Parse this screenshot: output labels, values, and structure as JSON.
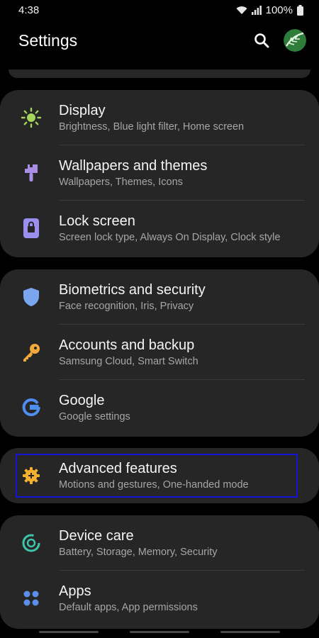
{
  "status": {
    "time": "4:38",
    "battery": "100%"
  },
  "header": {
    "title": "Settings"
  },
  "groups": [
    {
      "items": [
        {
          "title": "Display",
          "subtitle": "Brightness, Blue light filter, Home screen",
          "icon": "sun-icon",
          "color": "#a4d65e"
        },
        {
          "title": "Wallpapers and themes",
          "subtitle": "Wallpapers, Themes, Icons",
          "icon": "paintbrush-icon",
          "color": "#a98ee6"
        },
        {
          "title": "Lock screen",
          "subtitle": "Screen lock type, Always On Display, Clock style",
          "icon": "lock-icon",
          "color": "#9a8ef0"
        }
      ]
    },
    {
      "items": [
        {
          "title": "Biometrics and security",
          "subtitle": "Face recognition, Iris, Privacy",
          "icon": "shield-icon",
          "color": "#7aa6f0"
        },
        {
          "title": "Accounts and backup",
          "subtitle": "Samsung Cloud, Smart Switch",
          "icon": "key-icon",
          "color": "#f3a93a"
        },
        {
          "title": "Google",
          "subtitle": "Google settings",
          "icon": "google-icon",
          "color": "#4e8ef0"
        }
      ]
    },
    {
      "items": [
        {
          "title": "Advanced features",
          "subtitle": "Motions and gestures, One-handed mode",
          "icon": "gear-plus-icon",
          "color": "#f2b02e"
        }
      ]
    },
    {
      "items": [
        {
          "title": "Device care",
          "subtitle": "Battery, Storage, Memory, Security",
          "icon": "device-care-icon",
          "color": "#3ec4a8"
        },
        {
          "title": "Apps",
          "subtitle": "Default apps, App permissions",
          "icon": "apps-grid-icon",
          "color": "#5a8ee8"
        }
      ]
    }
  ],
  "highlight_color": "#1414d6"
}
